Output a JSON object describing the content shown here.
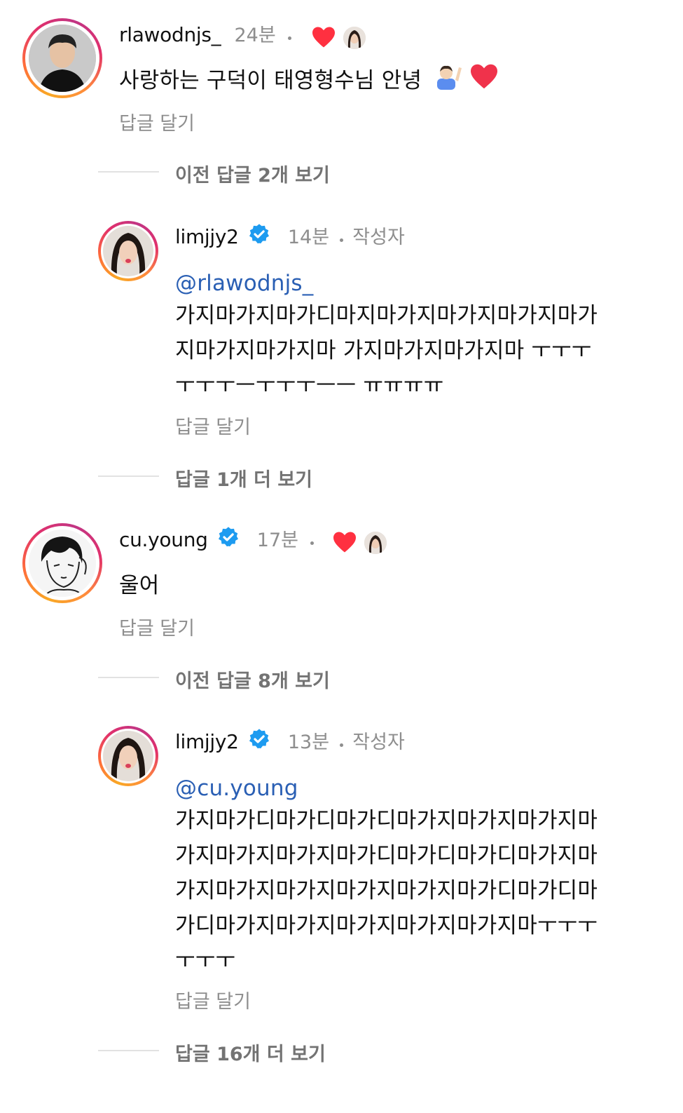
{
  "comments": [
    {
      "username": "rlawodnjs_",
      "time": "24분",
      "text": "사랑하는 구덕이 태영형수님 안녕",
      "reply_label": "답글 달기"
    },
    {
      "more": "이전 답글 2개 보기"
    },
    {
      "username": "limjjy2",
      "time": "14분",
      "author_badge": "작성자",
      "mention": "@rlawodnjs_",
      "lines": [
        "가지마가지마가디마지마가지마가지마가지마가",
        "지마가지마가지마 가지마가지마가지마 ㅜㅜㅜ",
        "ㅜㅜㅜㅡㅜㅜㅜㅡㅡ ㅠㅠㅠㅠ"
      ],
      "reply_label": "답글 달기"
    },
    {
      "more": "답글 1개 더 보기"
    },
    {
      "username": "cu.young",
      "time": "17분",
      "text": "울어",
      "reply_label": "답글 달기"
    },
    {
      "more": "이전 답글 8개 보기"
    },
    {
      "username": "limjjy2",
      "time": "13분",
      "author_badge": "작성자",
      "mention": "@cu.young",
      "lines": [
        "가지마가디마가디마가디마가지마가지마가지마",
        "가지마가지마가지마가디마가디마가디마가지마",
        "가지마가지마가지마가지마가지마가디마가디마",
        "가디마가지마가지마가지마가지마가지마ㅜㅜㅜ",
        "ㅜㅜㅜ"
      ],
      "reply_label": "답글 달기"
    },
    {
      "more": "답글 16개 더 보기"
    }
  ],
  "colors": {
    "heart": "#ff3040",
    "verified": "#1d9bf0",
    "mention": "#2a5fb4",
    "muted": "#8e8e8e"
  },
  "icons": [
    "heart-icon",
    "verified-badge-icon",
    "raising-hand-emoji",
    "red-heart-emoji"
  ]
}
